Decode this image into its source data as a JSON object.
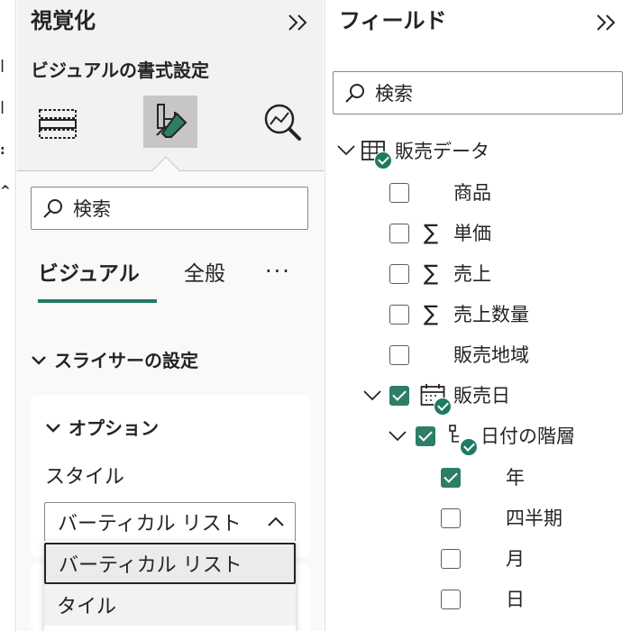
{
  "viz_pane": {
    "title": "視覚化",
    "subtitle": "ビジュアルの書式設定",
    "search_placeholder": "検索",
    "tabs": [
      {
        "label": "ビジュアル",
        "active": true
      },
      {
        "label": "全般",
        "active": false
      }
    ],
    "more_label": "···",
    "section_title": "スライサーの設定",
    "card_title": "オプション",
    "style_label": "スタイル",
    "style_value": "バーティカル リスト",
    "style_options": [
      "バーティカル リスト",
      "タイル"
    ]
  },
  "fields_pane": {
    "title": "フィールド",
    "search_placeholder": "検索",
    "table_name": "販売データ",
    "fields": [
      {
        "label": "商品",
        "checked": false,
        "sigma": false
      },
      {
        "label": "単価",
        "checked": false,
        "sigma": true
      },
      {
        "label": "売上",
        "checked": false,
        "sigma": true
      },
      {
        "label": "売上数量",
        "checked": false,
        "sigma": true
      },
      {
        "label": "販売地域",
        "checked": false,
        "sigma": false
      }
    ],
    "date_field": {
      "label": "販売日",
      "checked": true
    },
    "hierarchy": {
      "label": "日付の階層",
      "checked": true
    },
    "levels": [
      {
        "label": "年",
        "checked": true
      },
      {
        "label": "四半期",
        "checked": false
      },
      {
        "label": "月",
        "checked": false
      },
      {
        "label": "日",
        "checked": false
      }
    ]
  },
  "colors": {
    "accent": "#1f7a63",
    "pane_bg": "#f3f2f1",
    "check": "#2e7d67"
  }
}
